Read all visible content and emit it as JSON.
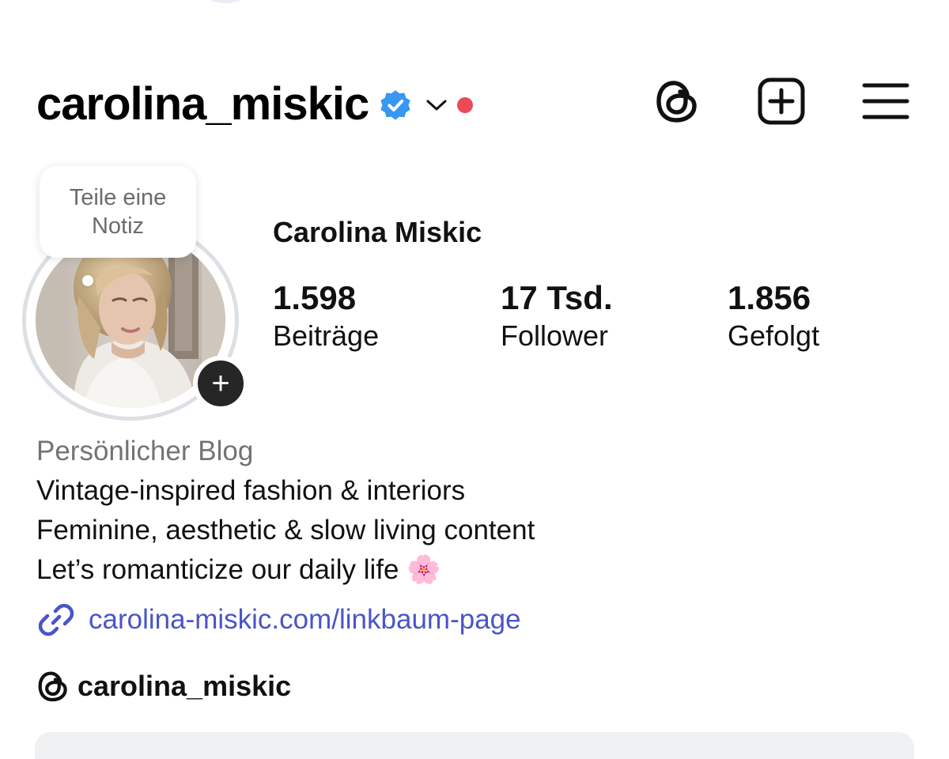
{
  "colors": {
    "verified_blue": "#3897f0",
    "notification_red": "#ed4956",
    "link_blue": "#4a55c7",
    "text_primary": "#111111",
    "text_secondary": "#737373"
  },
  "header": {
    "username": "carolina_miskic",
    "verified_icon": "verified-badge-icon",
    "dropdown_icon": "chevron-down-icon",
    "notification_dot": "red-dot",
    "actions": [
      {
        "name": "threads-icon"
      },
      {
        "name": "add-post-icon"
      },
      {
        "name": "menu-icon"
      }
    ]
  },
  "profile": {
    "note_prompt": "Teile eine Notiz",
    "add_story_label": "+",
    "display_name": "Carolina Miskic",
    "stats": [
      {
        "value": "1.598",
        "label": "Beiträge"
      },
      {
        "value": "17 Tsd.",
        "label": "Follower"
      },
      {
        "value": "1.856",
        "label": "Gefolgt"
      }
    ]
  },
  "bio": {
    "category": "Persönlicher Blog",
    "lines": [
      "Vintage-inspired fashion & interiors",
      "Feminine, aesthetic & slow living content",
      "Let’s romanticize our daily life 🌸"
    ],
    "link": "carolina-miskic.com/linkbaum-page",
    "threads_handle": "carolina_miskic"
  }
}
